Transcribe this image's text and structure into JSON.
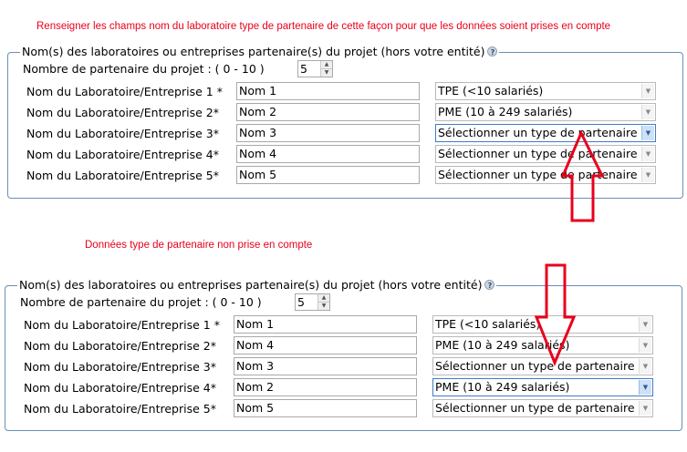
{
  "annotations": {
    "top": "Renseigner les champs nom du laboratoire  type de partenaire de cette façon pour que les données soient prises en compte",
    "middle": "Données type de partenaire non prise en compte"
  },
  "colors": {
    "annotation": "#e8001c",
    "arrow": "#e8001c",
    "fieldset_border": "#6a8fb5"
  },
  "forms": [
    {
      "legend": "Nom(s) des laboratoires ou entreprises partenaire(s) du projet (hors votre entité)",
      "count_label": "Nombre de partenaire du projet : ( 0 - 10 )",
      "count_value": "5",
      "rows": [
        {
          "label": "Nom du Laboratoire/Entreprise 1 *",
          "name": "Nom 1",
          "type": "TPE (<10 salariés)"
        },
        {
          "label": "Nom du Laboratoire/Entreprise 2*",
          "name": "Nom 2",
          "type": "PME (10 à 249 salariés)"
        },
        {
          "label": "Nom du Laboratoire/Entreprise 3*",
          "name": "Nom 3",
          "type": "Sélectionner un type de partenaire"
        },
        {
          "label": "Nom du Laboratoire/Entreprise 4*",
          "name": "Nom 4",
          "type": "Sélectionner un type de partenaire"
        },
        {
          "label": "Nom du Laboratoire/Entreprise 5*",
          "name": "Nom 5",
          "type": "Sélectionner un type de partenaire"
        }
      ]
    },
    {
      "legend": "Nom(s) des laboratoires ou entreprises partenaire(s) du projet (hors votre entité)",
      "count_label": "Nombre de partenaire du projet : ( 0 - 10 )",
      "count_value": "5",
      "rows": [
        {
          "label": "Nom du Laboratoire/Entreprise 1 *",
          "name": "Nom 1",
          "type": "TPE (<10 salariés)"
        },
        {
          "label": "Nom du Laboratoire/Entreprise 2*",
          "name": "Nom 4",
          "type": "PME (10 à 249 salariés)"
        },
        {
          "label": "Nom du Laboratoire/Entreprise 3*",
          "name": "Nom 3",
          "type": "Sélectionner un type de partenaire"
        },
        {
          "label": "Nom du Laboratoire/Entreprise 4*",
          "name": "Nom 2",
          "type": "PME (10 à 249 salariés)"
        },
        {
          "label": "Nom du Laboratoire/Entreprise 5*",
          "name": "Nom 5",
          "type": "Sélectionner un type de partenaire"
        }
      ]
    }
  ]
}
